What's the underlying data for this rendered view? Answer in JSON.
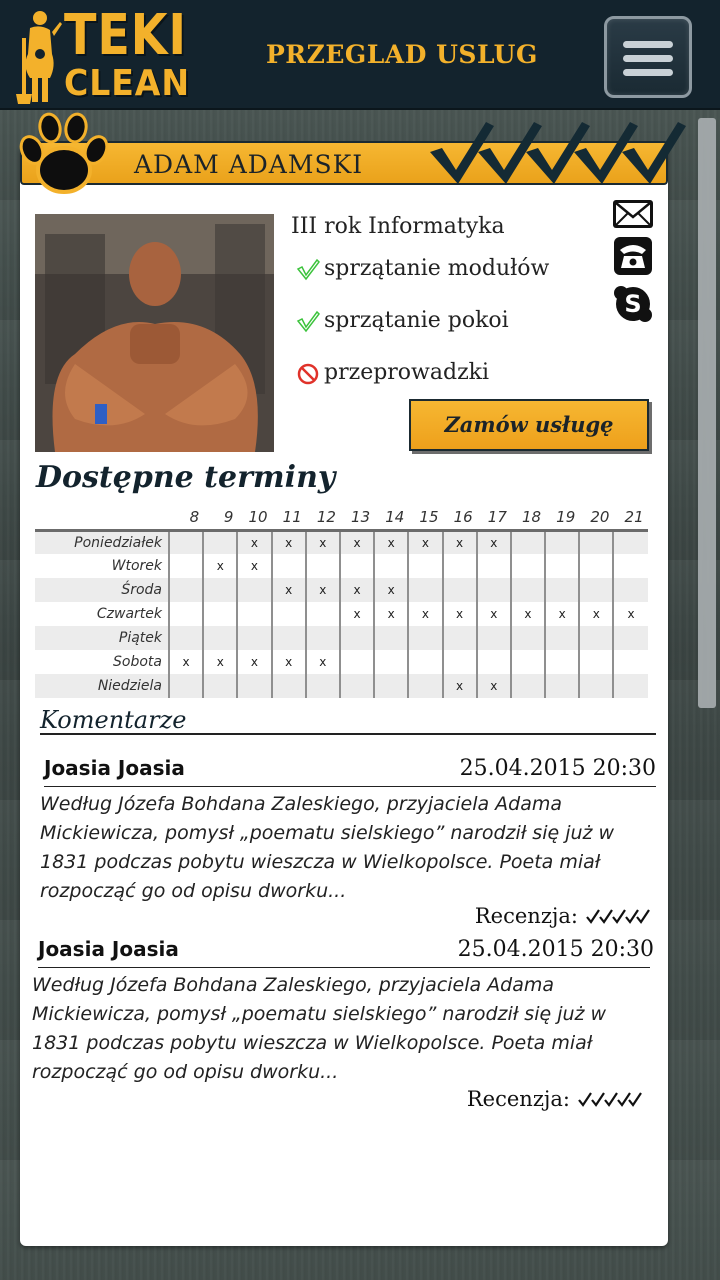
{
  "header": {
    "logo_line1": "TEKI",
    "logo_line2": "CLEAN",
    "title": "PRZEGLAD USLUG",
    "menu_icon": "hamburger-icon"
  },
  "profile": {
    "name": "ADAM ADAMSKI",
    "rating_marks": 5,
    "year": "III rok Informatyka",
    "services": [
      {
        "label": "sprzątanie modułów",
        "available": true,
        "icon": "check-icon"
      },
      {
        "label": "sprzątanie pokoi",
        "available": true,
        "icon": "check-icon"
      },
      {
        "label": "przeprowadzki",
        "available": false,
        "icon": "forbidden-icon"
      }
    ],
    "contacts": [
      "mail-icon",
      "phone-icon",
      "skype-icon"
    ],
    "order_label": "Zamów usługę"
  },
  "schedule": {
    "title": "Dostępne terminy",
    "hours": [
      "8",
      "9",
      "10",
      "11",
      "12",
      "13",
      "14",
      "15",
      "16",
      "17",
      "18",
      "19",
      "20",
      "21"
    ],
    "mark": "x",
    "days": [
      {
        "name": "Poniedziałek",
        "slots": [
          "",
          "",
          "x",
          "x",
          "x",
          "x",
          "x",
          "x",
          "x",
          "x",
          "",
          "",
          "",
          ""
        ]
      },
      {
        "name": "Wtorek",
        "slots": [
          "",
          "x",
          "x",
          "",
          "",
          "",
          "",
          "",
          "",
          "",
          "",
          "",
          "",
          ""
        ]
      },
      {
        "name": "Środa",
        "slots": [
          "",
          "",
          "",
          "x",
          "x",
          "x",
          "x",
          "",
          "",
          "",
          "",
          "",
          "",
          ""
        ]
      },
      {
        "name": "Czwartek",
        "slots": [
          "",
          "",
          "",
          "",
          "",
          "x",
          "x",
          "x",
          "x",
          "x",
          "x",
          "x",
          "x",
          "x"
        ]
      },
      {
        "name": "Piątek",
        "slots": [
          "",
          "",
          "",
          "",
          "",
          "",
          "",
          "",
          "",
          "",
          "",
          "",
          "",
          ""
        ]
      },
      {
        "name": "Sobota",
        "slots": [
          "x",
          "x",
          "x",
          "x",
          "x",
          "",
          "",
          "",
          "",
          "",
          "",
          "",
          "",
          ""
        ]
      },
      {
        "name": "Niedziela",
        "slots": [
          "",
          "",
          "",
          "",
          "",
          "",
          "",
          "",
          "x",
          "x",
          "",
          "",
          "",
          ""
        ]
      }
    ]
  },
  "comments": {
    "title": "Komentarze",
    "review_label": "Recenzja:",
    "items": [
      {
        "author": "Joasia Joasia",
        "date": "25.04.2015 20:30",
        "text": "Według Józefa Bohdana Zaleskiego, przyjaciela Adama Mickiewicza, pomysł „poematu sielskiego” narodził się już w 1831 podczas pobytu wieszcza w Wielkopolsce. Poeta miał rozpocząć go od opisu dworku...",
        "rating": 5
      },
      {
        "author": "Joasia Joasia",
        "date": "25.04.2015 20:30",
        "text": "Według Józefa Bohdana Zaleskiego, przyjaciela Adama Mickiewicza, pomysł „poematu sielskiego” narodził się już w 1831 podczas pobytu wieszcza w Wielkopolsce. Poeta miał rozpocząć go od opisu dworku...",
        "rating": 5
      }
    ]
  },
  "colors": {
    "accent": "#f3b12b",
    "header_bg": "#13232d",
    "check_green": "#3cc33c",
    "forbidden_red": "#e0322a"
  }
}
